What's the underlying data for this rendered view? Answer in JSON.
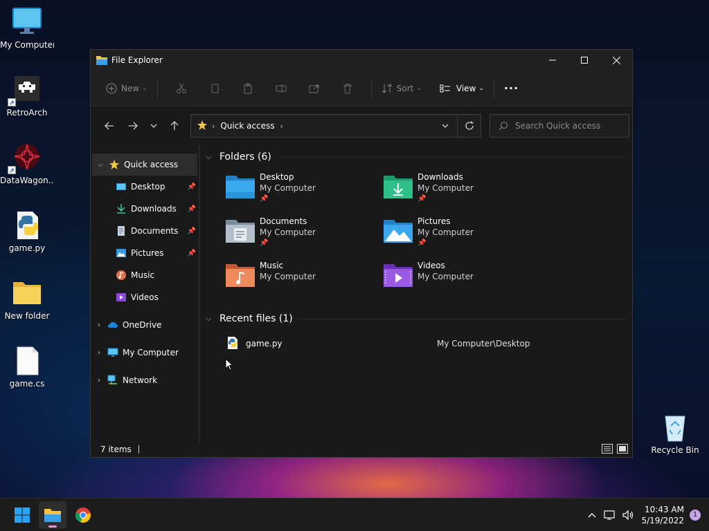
{
  "desktop": {
    "icons": [
      {
        "label": "My Computer"
      },
      {
        "label": "RetroArch"
      },
      {
        "label": "DataWagon..."
      },
      {
        "label": "game.py"
      },
      {
        "label": "New folder"
      },
      {
        "label": "game.cs"
      },
      {
        "label": "Recycle Bin"
      }
    ]
  },
  "window": {
    "title": "File Explorer",
    "toolbar": {
      "new_label": "New",
      "sort_label": "Sort",
      "view_label": "View",
      "more_label": "···"
    },
    "address": {
      "crumb": "Quick access",
      "search_placeholder": "Search Quick access"
    },
    "nav": {
      "quick_access": "Quick access",
      "pinned": [
        {
          "label": "Desktop"
        },
        {
          "label": "Downloads"
        },
        {
          "label": "Documents"
        },
        {
          "label": "Pictures"
        },
        {
          "label": "Music"
        },
        {
          "label": "Videos"
        }
      ],
      "onedrive": "OneDrive",
      "my_computer": "My Computer",
      "network": "Network"
    },
    "content": {
      "folders_header": "Folders (6)",
      "folders": [
        {
          "name": "Desktop",
          "location": "My Computer",
          "pinned": true
        },
        {
          "name": "Downloads",
          "location": "My Computer",
          "pinned": true
        },
        {
          "name": "Documents",
          "location": "My Computer",
          "pinned": true
        },
        {
          "name": "Pictures",
          "location": "My Computer",
          "pinned": true
        },
        {
          "name": "Music",
          "location": "My Computer",
          "pinned": false
        },
        {
          "name": "Videos",
          "location": "My Computer",
          "pinned": false
        }
      ],
      "recent_header": "Recent files (1)",
      "recent_files": [
        {
          "name": "game.py",
          "location": "My Computer\\Desktop"
        }
      ]
    },
    "status": {
      "items": "7 items"
    }
  },
  "taskbar": {
    "time": "10:43 AM",
    "date": "5/19/2022",
    "notification_count": "1"
  },
  "colors": {
    "window_bg": "#191919",
    "toolbar_bg": "#202020",
    "folder_blue": "#3aa0e8",
    "folder_yellow": "#f4c542",
    "accent_taskbar": "#e597d6"
  }
}
